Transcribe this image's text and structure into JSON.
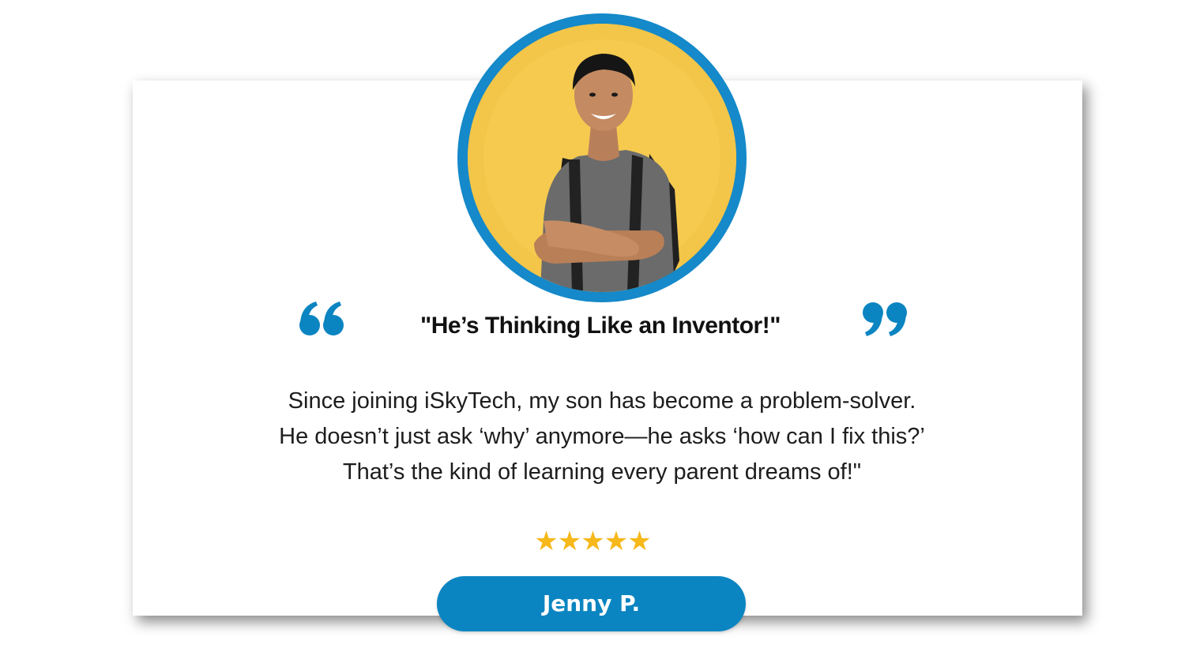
{
  "testimonial": {
    "headline": "\"He’s Thinking Like an Inventor!\"",
    "body_lines": [
      "Since joining iSkyTech, my son has become a problem-solver.",
      "He doesn’t just ask ‘why’ anymore—he asks ‘how can I fix this?’",
      "That’s the kind of learning every parent dreams of!\""
    ],
    "rating": {
      "stars_text": "★★★★★",
      "value": 5,
      "max": 5
    },
    "author": "Jenny P."
  },
  "icons": {
    "open_quote": "quote-open-icon",
    "close_quote": "quote-close-icon",
    "star": "star-icon"
  },
  "colors": {
    "accent_blue": "#0b85c1",
    "ring_blue": "#1589c9",
    "photo_background": "#f3c548",
    "star_gold": "#f6b81a",
    "headline_text": "#111111"
  }
}
